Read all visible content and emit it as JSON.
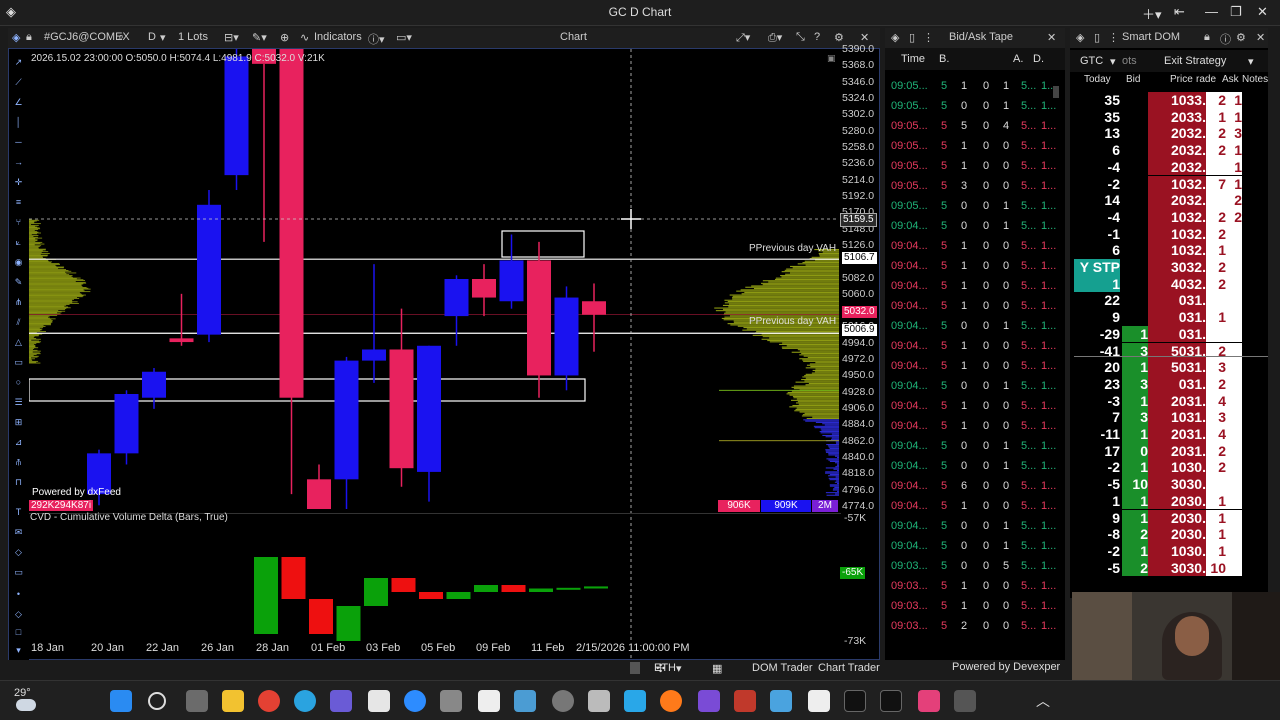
{
  "window": {
    "title": "GC D Chart"
  },
  "chart_panel": {
    "symbol": "#GCJ6@COMEX",
    "period": "D",
    "lots": "1 Lots",
    "indicators_label": "Indicators",
    "panel_title": "Chart",
    "ohlc_readout": "2026.15.02 23:00:00 O:5050.0 H:5074.4 L:4981.9 C:5032.0 V:21K",
    "powered_by": "Powered by dxFeed",
    "bottom_left_vol": "292K294K87i",
    "cvd_label": "CVD - Cumulative Volume Delta (Bars, True)",
    "vah_label_1": "PPrevious day VAH",
    "vah_label_2": "PPrevious day VAH",
    "vol_left": "906K",
    "vol_mid": "909K",
    "vol_right": "2M",
    "cursor_time": "2/15/2026 11:00:00 PM",
    "cursor_price": "5159.5",
    "bottom_tabs": {
      "session": "ETH",
      "dom_trader": "DOM Trader",
      "chart_trader": "Chart Trader"
    }
  },
  "chart_data": {
    "type": "candlestick",
    "price_axis": [
      "5390.0",
      "5368.0",
      "5346.0",
      "5324.0",
      "5302.0",
      "5280.0",
      "5258.0",
      "5236.0",
      "5214.0",
      "5192.0",
      "5170.0",
      "5148.0",
      "5126.0",
      "5104.0",
      "5082.0",
      "5060.0",
      "5038.0",
      "5016.0",
      "4994.0",
      "4972.0",
      "4950.0",
      "4928.0",
      "4906.0",
      "4884.0",
      "4862.0",
      "4840.0",
      "4818.0",
      "4796.0",
      "4774.0"
    ],
    "price_range": [
      4770,
      5390
    ],
    "badges": {
      "vah1": "5106.7",
      "close": "5032.0",
      "vah2": "5006.9"
    },
    "cvd_axis": [
      "-57K",
      "-65K",
      "-73K"
    ],
    "cvd_current": "-65K",
    "x_labels": [
      "18 Jan",
      "20 Jan",
      "22 Jan",
      "26 Jan",
      "28 Jan",
      "01 Feb",
      "03 Feb",
      "05 Feb",
      "09 Feb",
      "11 Feb"
    ],
    "candles": [
      {
        "o": 4790,
        "h": 4850,
        "l": 4775,
        "c": 4845,
        "up": true
      },
      {
        "o": 4845,
        "h": 4930,
        "l": 4830,
        "c": 4925,
        "up": true
      },
      {
        "o": 4920,
        "h": 4960,
        "l": 4905,
        "c": 4955,
        "up": true
      },
      {
        "o": 5000,
        "h": 5060,
        "l": 4990,
        "c": 4995,
        "up": false
      },
      {
        "o": 5005,
        "h": 5200,
        "l": 4995,
        "c": 5180,
        "up": true
      },
      {
        "o": 5220,
        "h": 5390,
        "l": 5200,
        "c": 5380,
        "up": true
      },
      {
        "o": 5390,
        "h": 5370,
        "l": 5130,
        "c": 5370,
        "up": false
      },
      {
        "o": 5390,
        "h": 5390,
        "l": 4790,
        "c": 4920,
        "up": false
      },
      {
        "o": 4770,
        "h": 4830,
        "l": 4770,
        "c": 4810,
        "up": false
      },
      {
        "o": 4810,
        "h": 4975,
        "l": 4770,
        "c": 4970,
        "up": true
      },
      {
        "o": 4970,
        "h": 5100,
        "l": 4940,
        "c": 4985,
        "up": true
      },
      {
        "o": 4985,
        "h": 5040,
        "l": 4800,
        "c": 4825,
        "up": false
      },
      {
        "o": 4820,
        "h": 4990,
        "l": 4780,
        "c": 4990,
        "up": true
      },
      {
        "o": 5030,
        "h": 5085,
        "l": 4990,
        "c": 5080,
        "up": true
      },
      {
        "o": 5080,
        "h": 5100,
        "l": 5030,
        "c": 5055,
        "up": false
      },
      {
        "o": 5050,
        "h": 5140,
        "l": 5040,
        "c": 5105,
        "up": true
      },
      {
        "o": 5105,
        "h": 5130,
        "l": 4920,
        "c": 4950,
        "up": false
      },
      {
        "o": 4950,
        "h": 5070,
        "l": 4930,
        "c": 5055,
        "up": true
      },
      {
        "o": 5050,
        "h": 5074,
        "l": 4982,
        "c": 5032,
        "up": false
      }
    ],
    "cvd_bars": [
      {
        "o": -72,
        "c": -61,
        "up": true
      },
      {
        "o": -61,
        "c": -67,
        "up": false
      },
      {
        "o": -67,
        "c": -72,
        "up": false
      },
      {
        "o": -73,
        "c": -68,
        "up": true
      },
      {
        "o": -68,
        "c": -64,
        "up": true
      },
      {
        "o": -64,
        "c": -66,
        "up": false
      },
      {
        "o": -66,
        "c": -67,
        "up": false
      },
      {
        "o": -67,
        "c": -66,
        "up": true
      },
      {
        "o": -66,
        "c": -65,
        "up": true
      },
      {
        "o": -65,
        "c": -66,
        "up": false
      },
      {
        "o": -66,
        "c": -65.5,
        "up": true
      },
      {
        "o": -65.6,
        "c": -65.4,
        "up": true
      },
      {
        "o": -65.5,
        "c": -65.2,
        "up": true
      }
    ],
    "grid": false
  },
  "tape": {
    "title": "Bid/Ask Tape",
    "headers": {
      "time": "Time",
      "b": "B.",
      "a": "A."
    },
    "rows": [
      {
        "time": "09:05...",
        "c": "5",
        "v": [
          "1",
          "0",
          "1"
        ],
        "col": "buy"
      },
      {
        "time": "09:05...",
        "c": "5",
        "v": [
          "0",
          "0",
          "1"
        ],
        "col": "buy"
      },
      {
        "time": "09:05...",
        "c": "5",
        "v": [
          "5",
          "0",
          "4"
        ],
        "col": "sell"
      },
      {
        "time": "09:05...",
        "c": "5",
        "v": [
          "1",
          "0",
          "0"
        ],
        "col": "sell"
      },
      {
        "time": "09:05...",
        "c": "5",
        "v": [
          "1",
          "0",
          "0"
        ],
        "col": "sell"
      },
      {
        "time": "09:05...",
        "c": "5",
        "v": [
          "3",
          "0",
          "0"
        ],
        "col": "sell"
      },
      {
        "time": "09:05...",
        "c": "5",
        "v": [
          "0",
          "0",
          "1"
        ],
        "col": "buy"
      },
      {
        "time": "09:04...",
        "c": "5",
        "v": [
          "0",
          "0",
          "1"
        ],
        "col": "buy"
      },
      {
        "time": "09:04...",
        "c": "5",
        "v": [
          "1",
          "0",
          "0"
        ],
        "col": "sell"
      },
      {
        "time": "09:04...",
        "c": "5",
        "v": [
          "1",
          "0",
          "0"
        ],
        "col": "sell"
      },
      {
        "time": "09:04...",
        "c": "5",
        "v": [
          "1",
          "0",
          "0"
        ],
        "col": "sell"
      },
      {
        "time": "09:04...",
        "c": "5",
        "v": [
          "1",
          "0",
          "0"
        ],
        "col": "sell"
      },
      {
        "time": "09:04...",
        "c": "5",
        "v": [
          "0",
          "0",
          "1"
        ],
        "col": "buy"
      },
      {
        "time": "09:04...",
        "c": "5",
        "v": [
          "1",
          "0",
          "0"
        ],
        "col": "sell"
      },
      {
        "time": "09:04...",
        "c": "5",
        "v": [
          "1",
          "0",
          "0"
        ],
        "col": "sell"
      },
      {
        "time": "09:04...",
        "c": "5",
        "v": [
          "0",
          "0",
          "1"
        ],
        "col": "buy"
      },
      {
        "time": "09:04...",
        "c": "5",
        "v": [
          "1",
          "0",
          "0"
        ],
        "col": "sell"
      },
      {
        "time": "09:04...",
        "c": "5",
        "v": [
          "1",
          "0",
          "0"
        ],
        "col": "sell"
      },
      {
        "time": "09:04...",
        "c": "5",
        "v": [
          "0",
          "0",
          "1"
        ],
        "col": "buy"
      },
      {
        "time": "09:04...",
        "c": "5",
        "v": [
          "0",
          "0",
          "1"
        ],
        "col": "buy"
      },
      {
        "time": "09:04...",
        "c": "5",
        "v": [
          "6",
          "0",
          "0"
        ],
        "col": "sell"
      },
      {
        "time": "09:04...",
        "c": "5",
        "v": [
          "1",
          "0",
          "0"
        ],
        "col": "sell"
      },
      {
        "time": "09:04...",
        "c": "5",
        "v": [
          "0",
          "0",
          "1"
        ],
        "col": "buy"
      },
      {
        "time": "09:04...",
        "c": "5",
        "v": [
          "0",
          "0",
          "1"
        ],
        "col": "buy"
      },
      {
        "time": "09:03...",
        "c": "5",
        "v": [
          "0",
          "0",
          "5"
        ],
        "col": "buy"
      },
      {
        "time": "09:03...",
        "c": "5",
        "v": [
          "1",
          "0",
          "0"
        ],
        "col": "sell"
      },
      {
        "time": "09:03...",
        "c": "5",
        "v": [
          "1",
          "0",
          "0"
        ],
        "col": "sell"
      },
      {
        "time": "09:03...",
        "c": "5",
        "v": [
          "2",
          "0",
          "0"
        ],
        "col": "sell"
      }
    ],
    "trunc": "5...",
    "trunc2": "1..."
  },
  "dom": {
    "title": "Smart DOM",
    "tif": "GTC",
    "obj": "ots",
    "strategy": "Exit Strategy",
    "headers": {
      "today": "Today",
      "bid": "Bid",
      "price": "Price",
      "trade": "rade",
      "ask": "Ask",
      "notes": "Notes"
    },
    "rows": [
      {
        "today": "35",
        "tc": "g",
        "bid": "",
        "price": "1033.",
        "trade": "2",
        "ask": "1"
      },
      {
        "today": "35",
        "tc": "g",
        "bid": "",
        "price": "2033.",
        "trade": "1",
        "ask": "1"
      },
      {
        "today": "13",
        "tc": "g",
        "bid": "",
        "price": "2032.",
        "trade": "2",
        "ask": "3"
      },
      {
        "today": "6",
        "tc": "g",
        "bid": "",
        "price": "2032.",
        "trade": "2",
        "ask": "1"
      },
      {
        "today": "-4",
        "tc": "r",
        "bid": "",
        "price": "2032.",
        "trade": "",
        "ask": "1"
      },
      {
        "today": "-2",
        "tc": "r",
        "bid": "",
        "price": "1032.",
        "trade": "7",
        "ask": "1"
      },
      {
        "today": "14",
        "tc": "g",
        "bid": "",
        "price": "2032.",
        "trade": "",
        "ask": "2"
      },
      {
        "today": "-4",
        "tc": "r",
        "bid": "",
        "price": "1032.",
        "trade": "2",
        "ask": "2"
      },
      {
        "today": "-1",
        "tc": "r",
        "bid": "",
        "price": "1032.",
        "trade": "2",
        "ask": ""
      },
      {
        "today": "6",
        "tc": "g",
        "bid": "",
        "price": "1032.",
        "trade": "1",
        "ask": ""
      },
      {
        "today": "Y STP",
        "tc": "s",
        "bid": "",
        "price": "3032.",
        "trade": "2",
        "ask": ""
      },
      {
        "today": "1",
        "tc": "s",
        "bid": "",
        "price": "4032.",
        "trade": "2",
        "ask": ""
      },
      {
        "today": "22",
        "tc": "g",
        "bid": "",
        "price": "031.",
        "trade": "",
        "ask": ""
      },
      {
        "today": "9",
        "tc": "g",
        "bid": "",
        "price": "031.",
        "trade": "1",
        "ask": ""
      },
      {
        "today": "-29",
        "tc": "r",
        "bid": "1",
        "price": "031.",
        "trade": "",
        "ask": ""
      },
      {
        "today": "-41",
        "tc": "r",
        "bid": "3",
        "price": "5031.",
        "trade": "2",
        "ask": ""
      },
      {
        "today": "20",
        "tc": "g",
        "bid": "1",
        "price": "5031.",
        "trade": "3",
        "ask": ""
      },
      {
        "today": "23",
        "tc": "g",
        "bid": "3",
        "price": "031.",
        "trade": "2",
        "ask": ""
      },
      {
        "today": "-3",
        "tc": "r",
        "bid": "1",
        "price": "2031.",
        "trade": "4",
        "ask": ""
      },
      {
        "today": "7",
        "tc": "g",
        "bid": "3",
        "price": "1031.",
        "trade": "3",
        "ask": ""
      },
      {
        "today": "-11",
        "tc": "r",
        "bid": "1",
        "price": "2031.",
        "trade": "4",
        "ask": ""
      },
      {
        "today": "17",
        "tc": "g",
        "bid": "0",
        "price": "2031.",
        "trade": "2",
        "ask": ""
      },
      {
        "today": "-2",
        "tc": "r",
        "bid": "1",
        "price": "1030.",
        "trade": "2",
        "ask": ""
      },
      {
        "today": "-5",
        "tc": "r",
        "bid": "10",
        "price": "3030.",
        "trade": "",
        "ask": ""
      },
      {
        "today": "1",
        "tc": "g",
        "bid": "1",
        "price": "2030.",
        "trade": "1",
        "ask": ""
      },
      {
        "today": "9",
        "tc": "g",
        "bid": "1",
        "price": "2030.",
        "trade": "1",
        "ask": ""
      },
      {
        "today": "-8",
        "tc": "r",
        "bid": "2",
        "price": "2030.",
        "trade": "1",
        "ask": ""
      },
      {
        "today": "-2",
        "tc": "r",
        "bid": "1",
        "price": "1030.",
        "trade": "1",
        "ask": ""
      },
      {
        "today": "-5",
        "tc": "r",
        "bid": "2",
        "price": "3030.",
        "trade": "10",
        "ask": ""
      }
    ]
  },
  "footer": {
    "powered_by": "Powered by Devexper"
  },
  "taskbar": {
    "weather": "29°"
  },
  "colors": {
    "up": "#1a12f0",
    "down": "#e8225e",
    "cvd_up": "#0aa10a",
    "cvd_down": "#ee1010",
    "profile": "#8d9a12",
    "accent": "#1e5ad8"
  }
}
